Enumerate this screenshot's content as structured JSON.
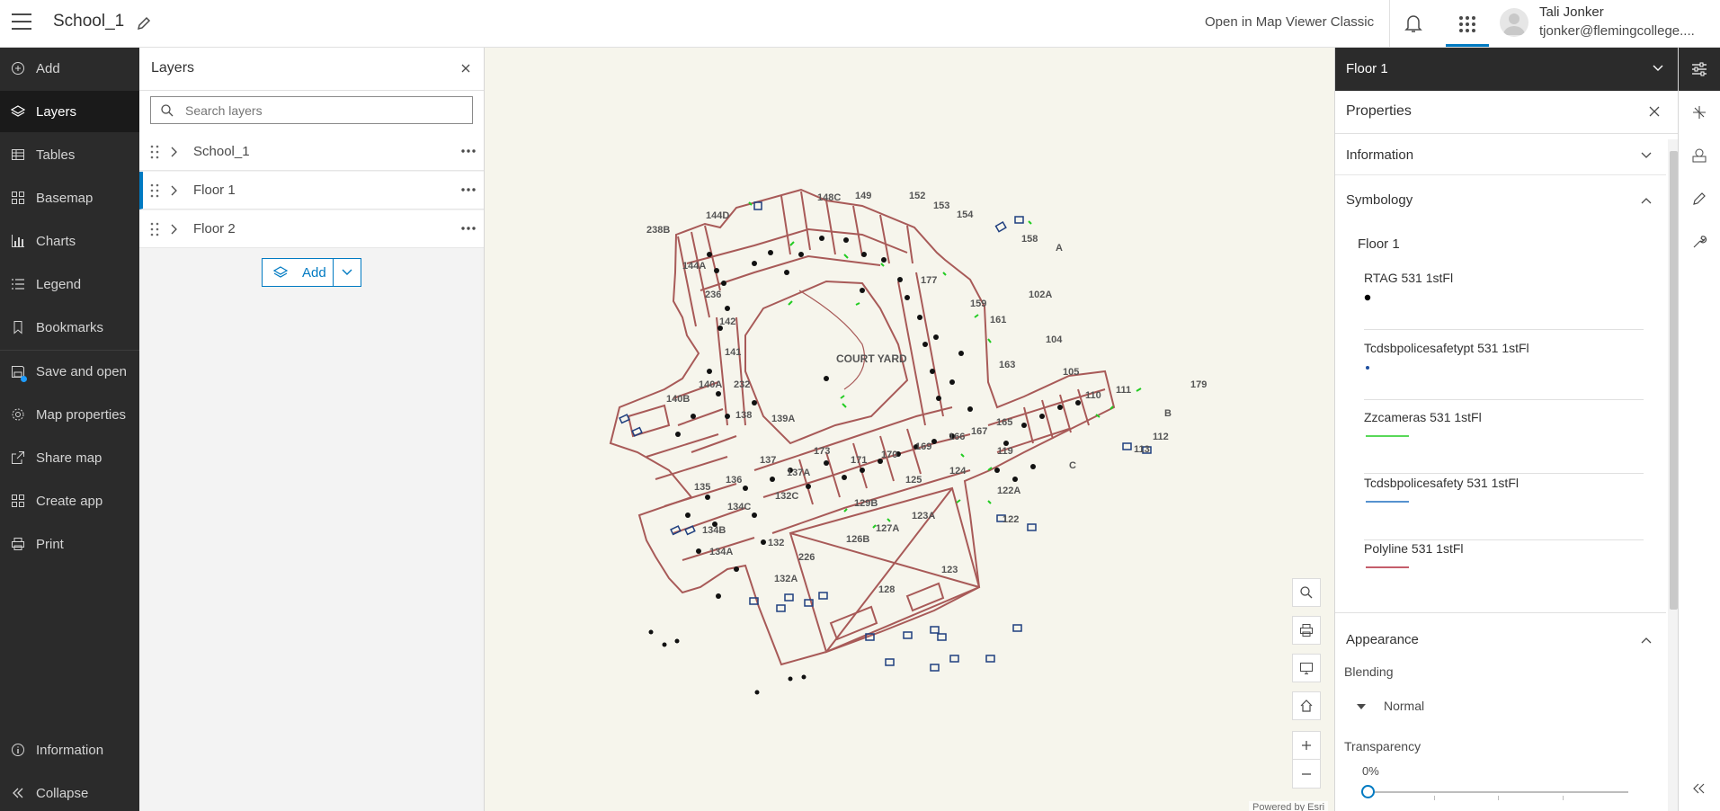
{
  "header": {
    "title": "School_1",
    "open_classic": "Open in Map Viewer Classic",
    "user_name": "Tali Jonker",
    "user_email": "tjonker@flemingcollege...."
  },
  "nav": {
    "items": [
      {
        "label": "Add",
        "icon": "add-circle-icon"
      },
      {
        "label": "Layers",
        "icon": "layers-icon"
      },
      {
        "label": "Tables",
        "icon": "table-icon"
      },
      {
        "label": "Basemap",
        "icon": "basemap-icon"
      },
      {
        "label": "Charts",
        "icon": "chart-icon"
      },
      {
        "label": "Legend",
        "icon": "legend-icon"
      },
      {
        "label": "Bookmarks",
        "icon": "bookmark-icon"
      },
      {
        "label": "Save and open",
        "icon": "save-icon"
      },
      {
        "label": "Map properties",
        "icon": "gear-icon"
      },
      {
        "label": "Share map",
        "icon": "share-icon"
      },
      {
        "label": "Create app",
        "icon": "apps-icon"
      },
      {
        "label": "Print",
        "icon": "print-icon"
      }
    ],
    "information": "Information",
    "collapse": "Collapse"
  },
  "layers_panel": {
    "title": "Layers",
    "search_placeholder": "Search layers",
    "layers": [
      {
        "name": "School_1",
        "selected": false
      },
      {
        "name": "Floor 1",
        "selected": true
      },
      {
        "name": "Floor 2",
        "selected": false
      }
    ],
    "add_label": "Add"
  },
  "map": {
    "courtyard_label": "COURT YARD",
    "room_labels": [
      "238B",
      "144D",
      "148C",
      "149",
      "152",
      "153",
      "154",
      "158",
      "144A",
      "236",
      "177",
      "159",
      "102A",
      "142",
      "161",
      "104",
      "141",
      "163",
      "105",
      "140A",
      "232",
      "140B",
      "138",
      "139A",
      "173",
      "171",
      "170",
      "169",
      "166",
      "167",
      "165",
      "137",
      "137A",
      "135",
      "136",
      "134C",
      "132C",
      "129B",
      "125",
      "124",
      "122A",
      "122",
      "134B",
      "132",
      "134A",
      "126B",
      "127A",
      "123A",
      "132A",
      "226",
      "123",
      "128",
      "110",
      "111",
      "179",
      "112",
      "113",
      "119",
      "A",
      "B",
      "C"
    ],
    "attribution": "Powered by Esri",
    "colors": {
      "background": "#f6f5ec",
      "walls": "#a85a58",
      "points": "#111111",
      "cameras": "#22cc22",
      "safety": "#1f3f7f"
    }
  },
  "properties": {
    "layer_selector": "Floor 1",
    "title": "Properties",
    "information_label": "Information",
    "symbology_label": "Symbology",
    "symbology_layer": "Floor 1",
    "symbols": [
      {
        "label": "RTAG 531 1stFl",
        "kind": "point",
        "color": "#000000"
      },
      {
        "label": "Tcdsbpolicesafetypt 531 1stFl",
        "kind": "small-point",
        "color": "#1f4f9f"
      },
      {
        "label": "Zzcameras 531 1stFl",
        "kind": "line",
        "color": "#22cc22"
      },
      {
        "label": "Tcdsbpolicesafety 531 1stFl",
        "kind": "line",
        "color": "#1f6fbf"
      },
      {
        "label": "Polyline 531 1stFl",
        "kind": "line",
        "color": "#b0283a"
      }
    ],
    "appearance_label": "Appearance",
    "blending_label": "Blending",
    "blending_value": "Normal",
    "transparency_label": "Transparency",
    "transparency_value": "0%"
  }
}
